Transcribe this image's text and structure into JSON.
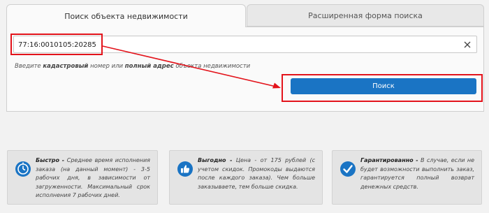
{
  "tabs": [
    {
      "label": "Поиск объекта недвижимости",
      "active": true
    },
    {
      "label": "Расширенная форма поиска",
      "active": false
    }
  ],
  "search": {
    "value": "77:16:0010105:20285",
    "placeholder": ""
  },
  "hint": {
    "prefix": "Введите ",
    "bold1": "кадастровый",
    "middle": " номер или ",
    "bold2": "полный адрес",
    "suffix": " объекта недвижимости"
  },
  "search_button": "Поиск",
  "cards": [
    {
      "icon": "clock-icon",
      "title": "Быстро -",
      "text": " Среднее время исполнения заказа (на данный момент) - 3-5 рабочих дня, в зависимости от загруженности. Максимальный срок исполнения 7 рабочих дней."
    },
    {
      "icon": "thumbs-up-icon",
      "title": "Выгодно -",
      "text": " Цена - от 175 рублей (с учетом скидок. Промокоды выдаются после каждого заказа). Чем больше заказываете, тем больше скидка."
    },
    {
      "icon": "checkmark-icon",
      "title": "Гарантированно -",
      "text": " В случае, если не будет возможности выполнить заказ, гарантируется полный возврат денежных средств."
    }
  ],
  "colors": {
    "accent": "#1a74c4",
    "highlight": "#e3131b"
  }
}
